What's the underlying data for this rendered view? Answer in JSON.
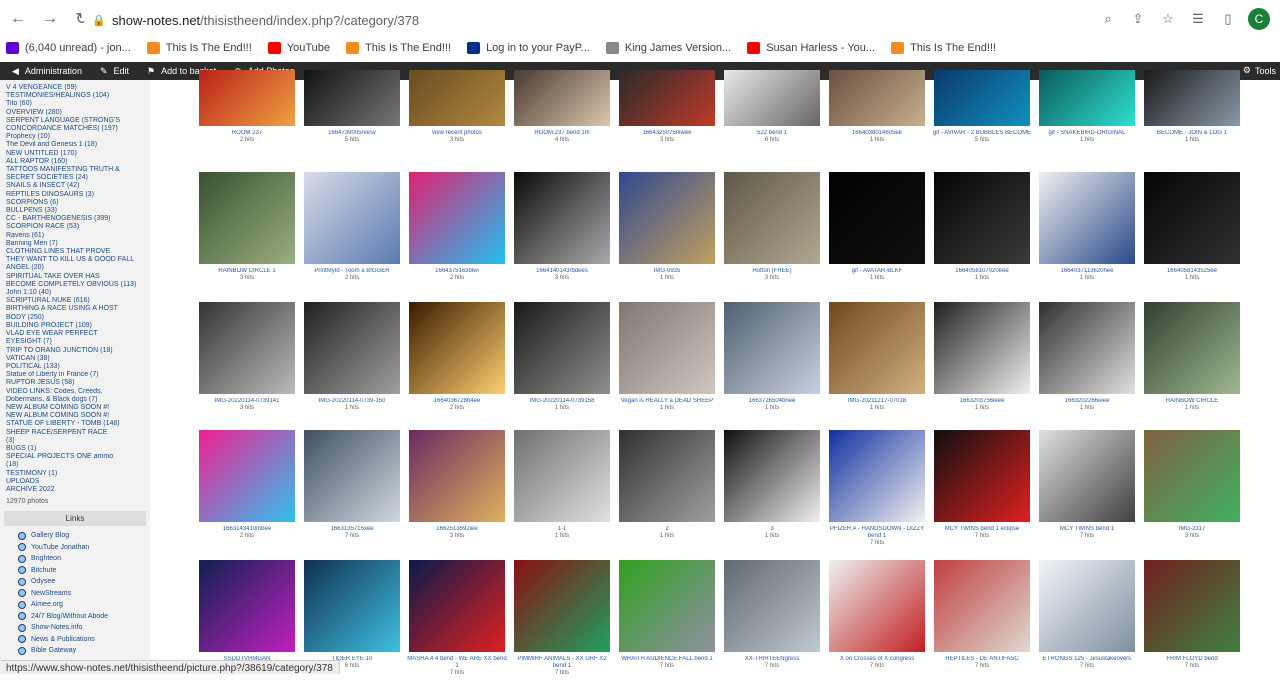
{
  "browser": {
    "url_host": "show-notes.net",
    "url_path": "/thisistheend/index.php?/category/378",
    "profile_initial": "C"
  },
  "bookmarks": [
    {
      "label": "(6,040 unread) - jon...",
      "color": "#6001d2"
    },
    {
      "label": "This Is The End!!!",
      "color": "#f28c1e"
    },
    {
      "label": "YouTube",
      "color": "#ff0000"
    },
    {
      "label": "This Is The End!!!",
      "color": "#f28c1e"
    },
    {
      "label": "Log in to your PayP...",
      "color": "#003087"
    },
    {
      "label": "King James Version...",
      "color": "#888888"
    },
    {
      "label": "Susan Harless - You...",
      "color": "#ff0000"
    },
    {
      "label": "This Is The End!!!",
      "color": "#f28c1e"
    }
  ],
  "admin_bar": {
    "administration": "Administration",
    "edit": "Edit",
    "add_to_basket": "Add to basket",
    "add_photos": "Add Photos",
    "tools": "Tools"
  },
  "menu": {
    "categories": [
      "V 4 VENGEANCE (59)",
      "TESTIMONIES/HEALINGS (104)",
      "Tito (60)",
      "OVERVIEW (280)",
      "SERPENT LANGUAGE (STRONG'S",
      "CONCORDANCE MATCHES) (197)",
      "Prophecy (10)",
      "The Devil and Genesis 1 (18)",
      "NEW UNTITLED (170)",
      "ALL RAPTOR (160)",
      "TATTOOS MANIFESTING TRUTH &",
      "SECRET SOCIETIES (24)",
      "SNAILS & INSECT (42)",
      "REPTILES DINOSAURS (3)",
      "SCORPIONS (6)",
      "BULLPENS (33)",
      "CC - BARTHENOGENESIS (399)",
      "SCORPION RACE (53)",
      "Ravens (61)",
      "Banning Men (7)",
      "CLOTHING LINES THAT PROVE",
      "THEY WANT TO KILL US & GOOD FALL",
      "ANGEL (20)",
      "SPIRITUAL TAKE OVER HAS",
      "BECOME COMPLETELY OBVIOUS (113)",
      "John 1:10 (40)",
      "SCRIPTURAL NUKE (616)",
      "BIRTHING A RACE USING A HOST",
      "BODY (250)",
      "BUILDING PROJECT (109)",
      "VLAD EYE WEAR PERFECT",
      "EYESIGHT (7)",
      "TRIP TO ORANG JUNCTION (18)",
      "VATICAN (38)",
      "POLITICAL (133)",
      "Statue of Liberty in France (7)",
      "RUPTOR JESUS (58)",
      "VIDEO LINKS: Codes, Creeds,",
      "Dobermans, & Black dogs (7)",
      "NEW ALBUM COMING SOON #!",
      "NEW ALBUM COMING SOON #!",
      "STATUE OF LIBERTY - TOMB (148)",
      "SHEEP RACE/SERPENT RACE",
      "(3)",
      "BUGS (1)",
      "SPECIAL PROJECTS ONE ammo",
      "(18)",
      "TESTIMONY (1)",
      "UPLOADS",
      "ARCHIVE 2022"
    ],
    "photos_count": "12970 photos",
    "links_header": "Links",
    "links": [
      "Gallery Blog",
      "YouTube Jonathan",
      "Brighteon",
      "Bitchute",
      "Odysee",
      "NewStreams",
      "Aimee.org",
      "24/7 Blog/Without Abode",
      "Show-Notes.info",
      "News & Publications",
      "Bible Gateway"
    ]
  },
  "thumbs": [
    {
      "cap": "ROOM 237",
      "sub": "2 hits",
      "colors": [
        "#b8211a",
        "#f0a040"
      ]
    },
    {
      "cap": "1664739005rvesv",
      "sub": "5 hits",
      "colors": [
        "#111",
        "#777"
      ]
    },
    {
      "cap": "view recent photos",
      "sub": "3 hits",
      "colors": [
        "#6b4a20",
        "#b08a40"
      ]
    },
    {
      "cap": "ROOM 237 bend 1m",
      "sub": "4 hits",
      "colors": [
        "#4a3a30",
        "#dcc8b0"
      ]
    },
    {
      "cap": "1664325075nlwee",
      "sub": "3 hits",
      "colors": [
        "#2a2a2a",
        "#c03a2a"
      ]
    },
    {
      "cap": "522 bend 1",
      "sub": "6 hits",
      "colors": [
        "#e8e8e8",
        "#666"
      ]
    },
    {
      "cap": "1664038014605ee",
      "sub": "1 hits",
      "colors": [
        "#6a5040",
        "#c8b090"
      ]
    },
    {
      "cap": "gif - AVIVAR - 2 BUBBLES BECOME",
      "sub": "5 hits",
      "colors": [
        "#0a3a6a",
        "#1090c0"
      ]
    },
    {
      "cap": "gif - SNAKEBIRD-ORIGINAL",
      "sub": "1 hits",
      "colors": [
        "#0a5a5a",
        "#30e0d0"
      ]
    },
    {
      "cap": "BECOME - JOIN & LOG 1",
      "sub": "1 hits",
      "colors": [
        "#1a1a1a",
        "#8a9aa8"
      ]
    },
    {
      "cap": "RAINBOW CIRCLE 1",
      "sub": "3 hits",
      "colors": [
        "#3a5030",
        "#9ab080"
      ]
    },
    {
      "cap": "PrintMyId - Toom a BIGGER",
      "sub": "2 hits",
      "colors": [
        "#d8dce8",
        "#5a7ab0"
      ]
    },
    {
      "cap": "1664375163blwi",
      "sub": "2 hits",
      "colors": [
        "#e02070",
        "#20c0f0"
      ]
    },
    {
      "cap": "1664140143rbdees",
      "sub": "3 hits",
      "colors": [
        "#0a0a0a",
        "#aaa"
      ]
    },
    {
      "cap": "IMG-0935",
      "sub": "1 hits",
      "colors": [
        "#304890",
        "#c0a060"
      ]
    },
    {
      "cap": "Hotton (FREE)",
      "sub": "3 hits",
      "colors": [
        "#605848",
        "#b0a890"
      ]
    },
    {
      "cap": "gif - AVATAR-BLKF",
      "sub": "1 hits",
      "colors": [
        "#000",
        "#111"
      ]
    },
    {
      "cap": "1664058107020eee",
      "sub": "1 hits",
      "colors": [
        "#050505",
        "#3a3a3a"
      ]
    },
    {
      "cap": "1664037113620hee",
      "sub": "1 hits",
      "colors": [
        "#f0f0f0",
        "#2a4a8a"
      ]
    },
    {
      "cap": "1664058143525ee",
      "sub": "1 hits",
      "colors": [
        "#050505",
        "#303030"
      ]
    },
    {
      "cap": "IMG-20220114-0739141",
      "sub": "3 hits",
      "colors": [
        "#333",
        "#bbb"
      ]
    },
    {
      "cap": "IMG-20220114-0739-150",
      "sub": "1 hits",
      "colors": [
        "#202020",
        "#a0a0a0"
      ]
    },
    {
      "cap": "1664036728b4ee",
      "sub": "2 hits",
      "colors": [
        "#3a1a00",
        "#ffd070"
      ]
    },
    {
      "cap": "IMG-20220114-0739158",
      "sub": "1 hits",
      "colors": [
        "#181818",
        "#909090"
      ]
    },
    {
      "cap": "Vegan is REALLY a DEAD SHEEP",
      "sub": "1 hits",
      "colors": [
        "#807870",
        "#d0c8c0"
      ]
    },
    {
      "cap": "1663726504bnee",
      "sub": "1 hits",
      "colors": [
        "#506070",
        "#c8d0e0"
      ]
    },
    {
      "cap": "IMG-20211217-07018",
      "sub": "1 hits",
      "colors": [
        "#704820",
        "#d0b080"
      ]
    },
    {
      "cap": "1663203756ieee",
      "sub": "1 hits",
      "colors": [
        "#202020",
        "#f0f0f0"
      ]
    },
    {
      "cap": "1663202266ieee",
      "sub": "1 hits",
      "colors": [
        "#303030",
        "#e0e0e0"
      ]
    },
    {
      "cap": "RAINBOW CIRCLE",
      "sub": "1 hits",
      "colors": [
        "#304030",
        "#a0b890"
      ]
    },
    {
      "cap": "1663143410mbee",
      "sub": "2 hits",
      "colors": [
        "#f02090",
        "#30c0f0"
      ]
    },
    {
      "cap": "1663135715xee",
      "sub": "7 hits",
      "colors": [
        "#405060",
        "#d0d8e0"
      ]
    },
    {
      "cap": "1662513592iee",
      "sub": "3 hits",
      "colors": [
        "#6a2a60",
        "#e0b060"
      ]
    },
    {
      "cap": "1-1",
      "sub": "1 hits",
      "colors": [
        "#707070",
        "#e0e0e0"
      ]
    },
    {
      "cap": "2",
      "sub": "1 hits",
      "colors": [
        "#303030",
        "#a0a0a0"
      ]
    },
    {
      "cap": "3",
      "sub": "1 hits",
      "colors": [
        "#101010",
        "#f0f0f0"
      ]
    },
    {
      "cap": "PFIZER A - HANDSDOWN - DIZZY bend 1",
      "sub": "7 hits",
      "colors": [
        "#1030a0",
        "#f0f0f0"
      ]
    },
    {
      "cap": "MCY TWINS bend 1 eclipse",
      "sub": "7 hits",
      "colors": [
        "#101010",
        "#e02020"
      ]
    },
    {
      "cap": "MCY TWINS bend 1",
      "sub": "7 hits",
      "colors": [
        "#e0e0e0",
        "#404040"
      ]
    },
    {
      "cap": "IMG-2317",
      "sub": "3 hits",
      "colors": [
        "#806040",
        "#40b060"
      ]
    },
    {
      "cap": "SSDDTVHMGAN",
      "sub": "",
      "colors": [
        "#102050",
        "#c020c0"
      ]
    },
    {
      "cap": "TIGER EYE 10",
      "sub": "6 hits",
      "colors": [
        "#103050",
        "#40c0e0"
      ]
    },
    {
      "cap": "MASHA 4 4 bend - WE ARE XX bend 1",
      "sub": "7 hits",
      "colors": [
        "#0a1a4a",
        "#e02020"
      ]
    },
    {
      "cap": "PIMMIRF ANIMALS - XX URF X2 bend 1",
      "sub": "7 hits",
      "colors": [
        "#8a1010",
        "#20a060"
      ]
    },
    {
      "cap": "WRAITH AUDIENCE FALL bend 1",
      "sub": "7 hits",
      "colors": [
        "#30a020",
        "#9090a0"
      ]
    },
    {
      "cap": "XX-THIRTEENgress",
      "sub": "7 hits",
      "colors": [
        "#606870",
        "#c0c8d0"
      ]
    },
    {
      "cap": "X on Crosses of X congress",
      "sub": "7 hits",
      "colors": [
        "#f0f0f0",
        "#c02020"
      ]
    },
    {
      "cap": "REPTILES - DE ANTIFASC",
      "sub": "7 hits",
      "colors": [
        "#c04040",
        "#e0d8d0"
      ]
    },
    {
      "cap": "ETRONGS 125 - Jesustakeovers",
      "sub": "7 hits",
      "colors": [
        "#f0f4f8",
        "#8090a0"
      ]
    },
    {
      "cap": "FRIM FLOYD bend",
      "sub": "7 hits",
      "colors": [
        "#702020",
        "#408040"
      ]
    }
  ],
  "status_bar": "https://www.show-notes.net/thisistheend/picture.php?/38619/category/378"
}
